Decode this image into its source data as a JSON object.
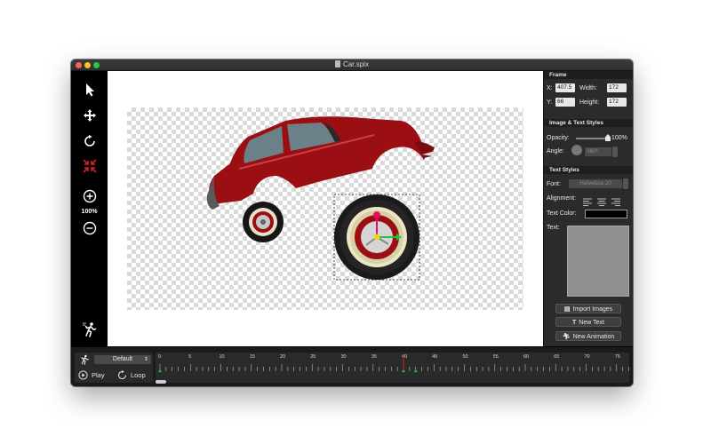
{
  "window": {
    "title": "Car.spix"
  },
  "toolbar": {
    "tools": [
      {
        "name": "select-arrow-icon"
      },
      {
        "name": "move-icon"
      },
      {
        "name": "rotate-icon"
      },
      {
        "name": "scale-icon"
      },
      {
        "name": "zoom-in-icon"
      },
      {
        "name": "zoom-out-icon"
      },
      {
        "name": "walking-figure-icon"
      }
    ],
    "zoom_label": "100%"
  },
  "colors": {
    "accent_red": "#d42222",
    "car_red": "#9b0f14",
    "selection": "#222222"
  },
  "inspector": {
    "frame": {
      "header": "Frame",
      "x_label": "X:",
      "x_value": "407.5",
      "width_label": "Width:",
      "width_value": "172",
      "y_label": "Y:",
      "y_value": "66",
      "height_label": "Height:",
      "height_value": "172"
    },
    "image_text_styles": {
      "header": "Image & Text Styles",
      "opacity_label": "Opacity:",
      "opacity_value": "100%",
      "angle_label": "Angle:",
      "angle_value": "360°"
    },
    "text_styles": {
      "header": "Text Styles",
      "font_label": "Font:",
      "font_value": "Helvetica 20",
      "alignment_label": "Alignment:",
      "text_color_label": "Text Color:",
      "text_label": "Text:"
    },
    "buttons": {
      "import_images": "Import Images",
      "new_text": "New Text",
      "new_animation": "New Animation"
    }
  },
  "timeline": {
    "animation_select": "Default",
    "play_label": "Play",
    "loop_label": "Loop",
    "ticks": [
      "0",
      "5",
      "10",
      "15",
      "20",
      "25",
      "30",
      "35",
      "40",
      "45",
      "50",
      "55",
      "60",
      "65",
      "70",
      "75"
    ]
  }
}
